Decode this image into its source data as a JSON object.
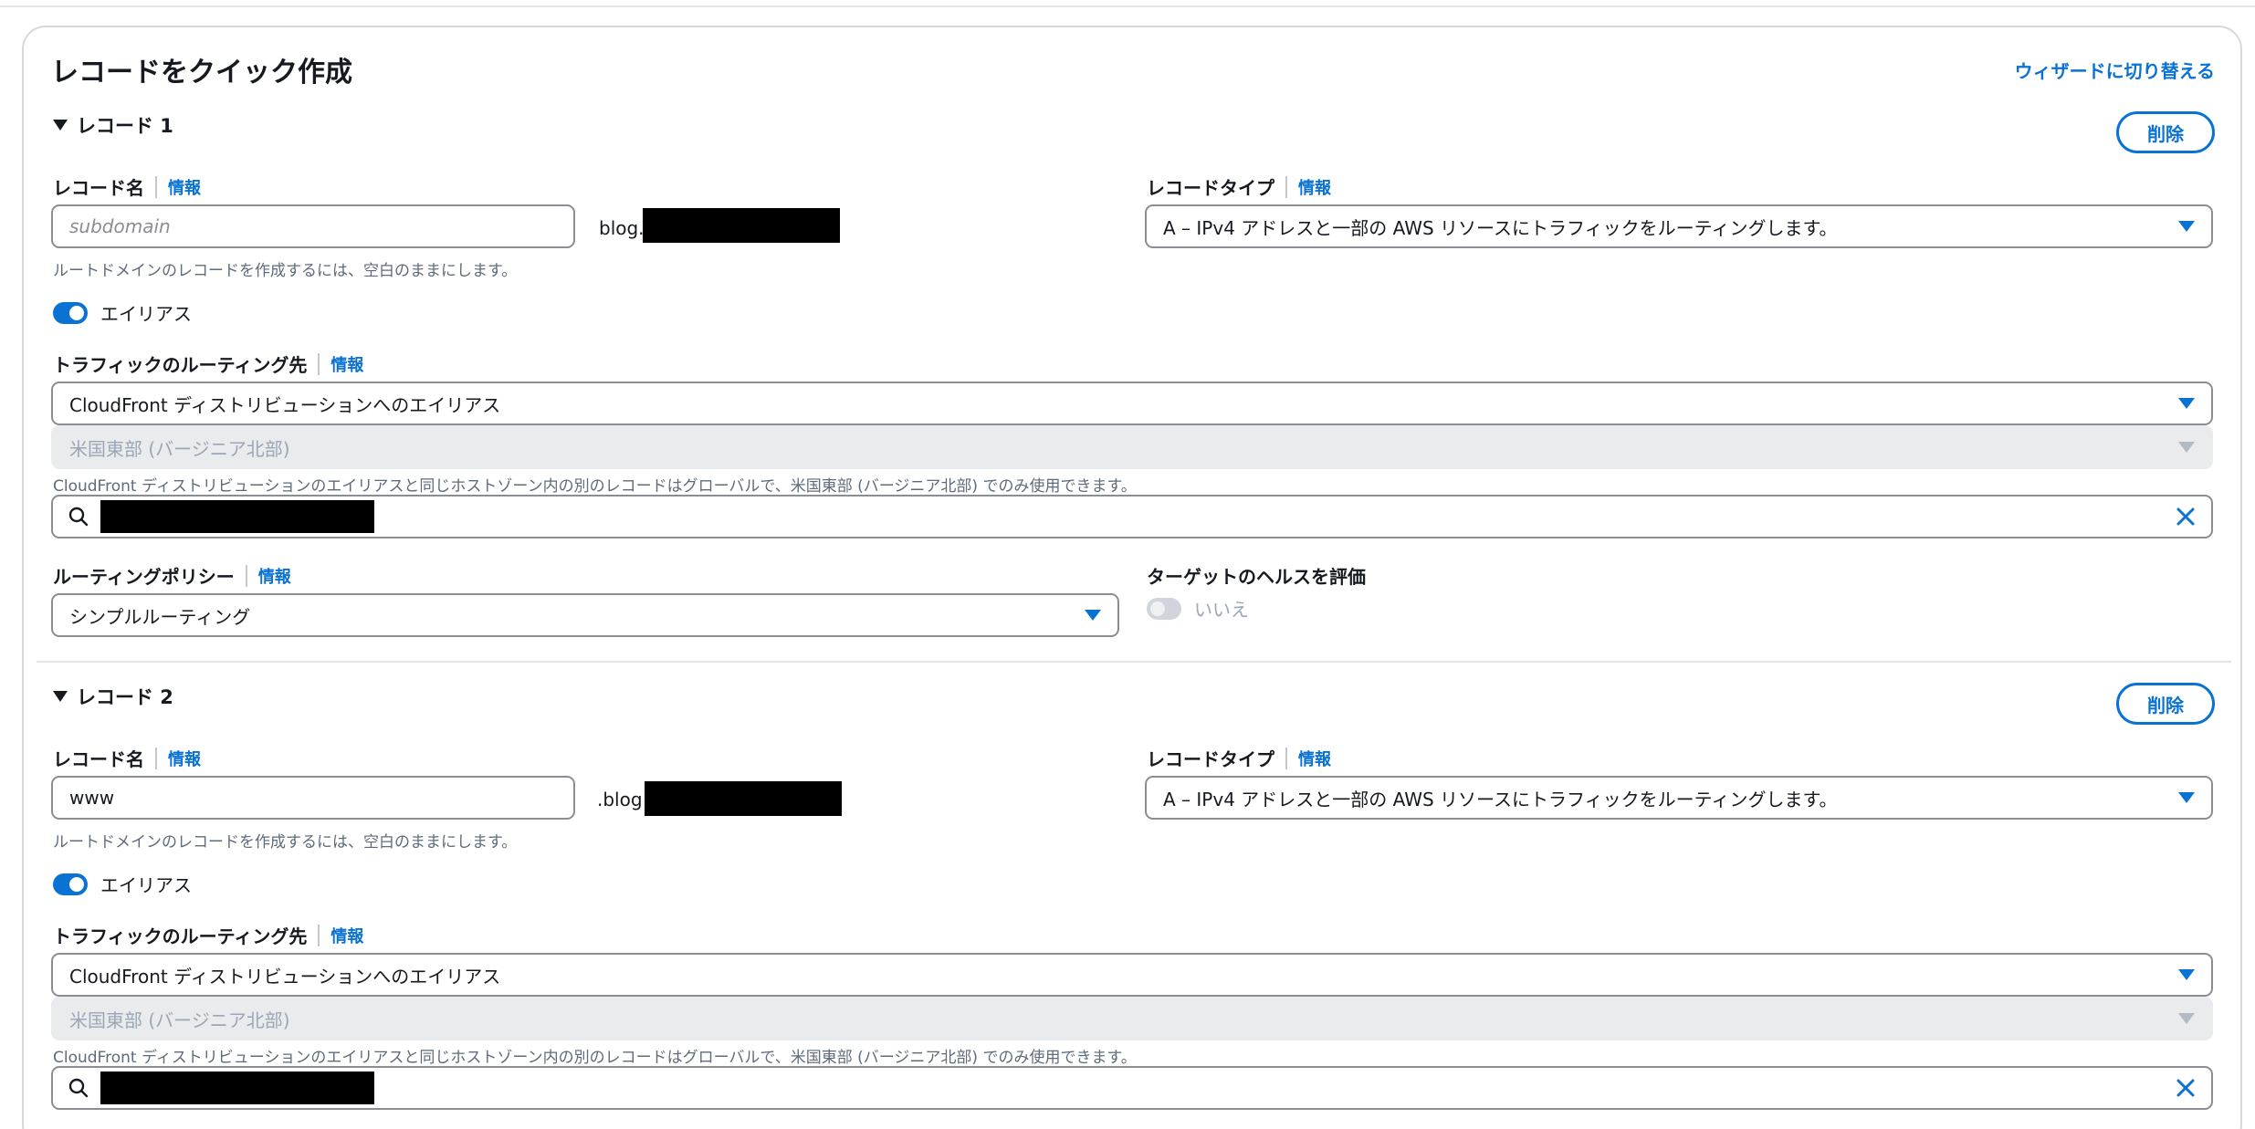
{
  "panel": {
    "title": "レコードをクイック作成",
    "wizard_link": "ウィザードに切り替える"
  },
  "records": [
    {
      "heading": "レコード 1",
      "delete_label": "削除",
      "name_label": "レコード名",
      "info": "情報",
      "name_value": "",
      "name_placeholder": "subdomain",
      "domain_suffix": "blog.",
      "hint": "ルートドメインのレコードを作成するには、空白のままにします。",
      "type_label": "レコードタイプ",
      "type_value": "A – IPv4 アドレスと一部の AWS リソースにトラフィックをルーティングします。",
      "alias_label": "エイリアス",
      "route_label": "トラフィックのルーティング先",
      "route_value": "CloudFront ディストリビューションへのエイリアス",
      "region_value": "米国東部 (バージニア北部)",
      "region_hint": "CloudFront ディストリビューションのエイリアスと同じホストゾーン内の別のレコードはグローバルで、米国東部 (バージニア北部) でのみ使用できます。",
      "policy_label": "ルーティングポリシー",
      "policy_value": "シンプルルーティング",
      "health_label": "ターゲットのヘルスを評価",
      "health_value": "いいえ"
    },
    {
      "heading": "レコード 2",
      "delete_label": "削除",
      "name_label": "レコード名",
      "info": "情報",
      "name_value": "www",
      "domain_suffix": ".blog",
      "hint": "ルートドメインのレコードを作成するには、空白のままにします。",
      "type_label": "レコードタイプ",
      "type_value": "A – IPv4 アドレスと一部の AWS リソースにトラフィックをルーティングします。",
      "alias_label": "エイリアス",
      "route_label": "トラフィックのルーティング先",
      "route_value": "CloudFront ディストリビューションへのエイリアス",
      "region_value": "米国東部 (バージニア北部)",
      "region_hint": "CloudFront ディストリビューションのエイリアスと同じホストゾーン内の別のレコードはグローバルで、米国東部 (バージニア北部) でのみ使用できます。"
    }
  ]
}
